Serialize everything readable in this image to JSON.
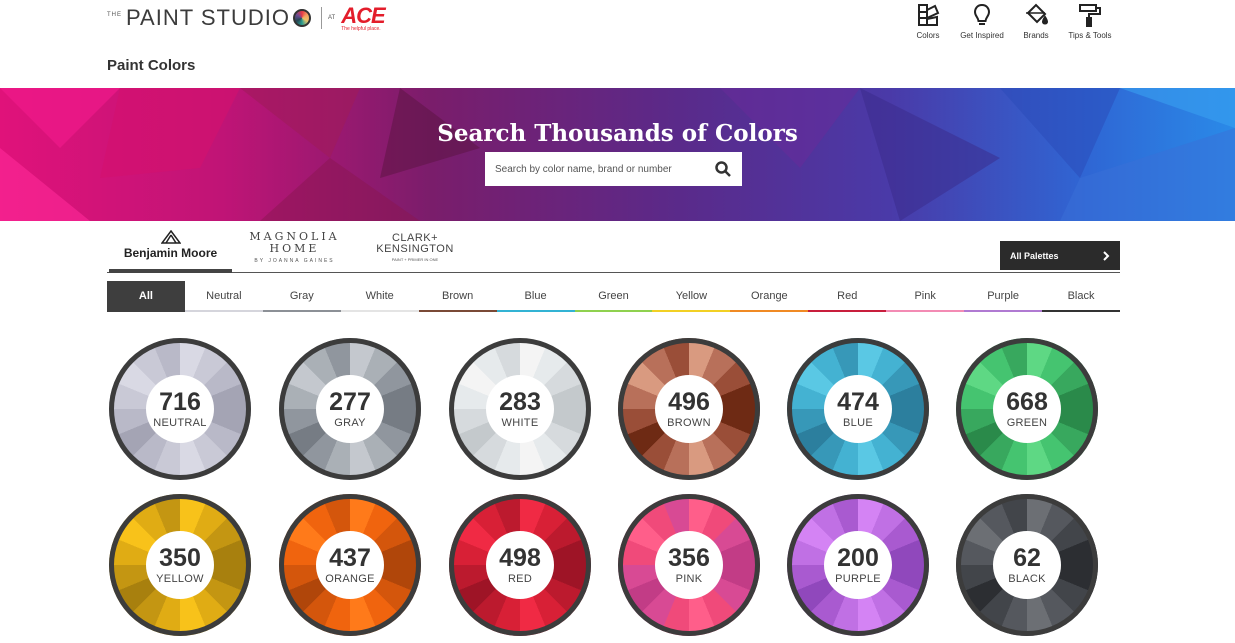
{
  "header": {
    "logo_the": "THE",
    "logo_word": "PAINT STUDIO",
    "logo_at": "AT",
    "ace_word": "ACE",
    "ace_tag": "The helpful place.",
    "nav": [
      {
        "label": "Colors",
        "icon": "swatch-icon"
      },
      {
        "label": "Get Inspired",
        "icon": "lightbulb-icon"
      },
      {
        "label": "Brands",
        "icon": "paint-bucket-icon"
      },
      {
        "label": "Tips & Tools",
        "icon": "paint-roller-icon"
      }
    ]
  },
  "page_title": "Paint Colors",
  "banner": {
    "title": "Search Thousands of Colors",
    "search_placeholder": "Search by color name, brand or number"
  },
  "brands": {
    "benjamin_moore": "Benjamin Moore",
    "magnolia_line1": "MAGNOLIA",
    "magnolia_line2": "HOME",
    "magnolia_line3": "BY JOANNA GAINES",
    "clark_line1": "CLARK+",
    "clark_line2": "KENSINGTON",
    "clark_line3": "PAINT + PRIMER IN ONE",
    "all_palettes": "All Palettes"
  },
  "tabs": [
    {
      "label": "All",
      "color": "#3e3e3e"
    },
    {
      "label": "Neutral",
      "color": "#d5d5dc"
    },
    {
      "label": "Gray",
      "color": "#8c9096"
    },
    {
      "label": "White",
      "color": "#e4e4e4"
    },
    {
      "label": "Brown",
      "color": "#7a4a36"
    },
    {
      "label": "Blue",
      "color": "#32b3d4"
    },
    {
      "label": "Green",
      "color": "#8fd14f"
    },
    {
      "label": "Yellow",
      "color": "#f2d024"
    },
    {
      "label": "Orange",
      "color": "#f08a24"
    },
    {
      "label": "Red",
      "color": "#c81e3c"
    },
    {
      "label": "Pink",
      "color": "#f38bb4"
    },
    {
      "label": "Purple",
      "color": "#b07ad2"
    },
    {
      "label": "Black",
      "color": "#333333"
    }
  ],
  "wheels": [
    {
      "count": "716",
      "label": "NEUTRAL",
      "colors": [
        "#d9d9e4",
        "#c9c9d6",
        "#b9b9c8",
        "#a4a4b4"
      ]
    },
    {
      "count": "277",
      "label": "GRAY",
      "colors": [
        "#c4c8ce",
        "#aab0b6",
        "#90969e",
        "#767c84"
      ]
    },
    {
      "count": "283",
      "label": "WHITE",
      "colors": [
        "#f4f4f4",
        "#e6eaec",
        "#d6dadd",
        "#c4c9cc"
      ]
    },
    {
      "count": "496",
      "label": "BROWN",
      "colors": [
        "#d99a80",
        "#b8705a",
        "#9a4e38",
        "#6e2a14"
      ]
    },
    {
      "count": "474",
      "label": "BLUE",
      "colors": [
        "#5ac8e4",
        "#44b2d2",
        "#3798b8",
        "#2c7f9e"
      ]
    },
    {
      "count": "668",
      "label": "GREEN",
      "colors": [
        "#5ed884",
        "#45c470",
        "#38a85e",
        "#2a8a4a"
      ]
    },
    {
      "count": "350",
      "label": "YELLOW",
      "colors": [
        "#f8c21a",
        "#e0ac14",
        "#c49612",
        "#a8800e"
      ]
    },
    {
      "count": "437",
      "label": "ORANGE",
      "colors": [
        "#ff7a1a",
        "#f0640e",
        "#d4560c",
        "#b0460a"
      ]
    },
    {
      "count": "498",
      "label": "RED",
      "colors": [
        "#f02a44",
        "#d82036",
        "#bc1a2e",
        "#9e1426"
      ]
    },
    {
      "count": "356",
      "label": "PINK",
      "colors": [
        "#ff5e8a",
        "#f04a7a",
        "#d84a94",
        "#c23c86"
      ]
    },
    {
      "count": "200",
      "label": "PURPLE",
      "colors": [
        "#d483f4",
        "#c070e4",
        "#a95ad0",
        "#9048bc"
      ]
    },
    {
      "count": "62",
      "label": "BLACK",
      "colors": [
        "#6c6f74",
        "#55585e",
        "#42454a",
        "#2c2e32"
      ]
    }
  ]
}
